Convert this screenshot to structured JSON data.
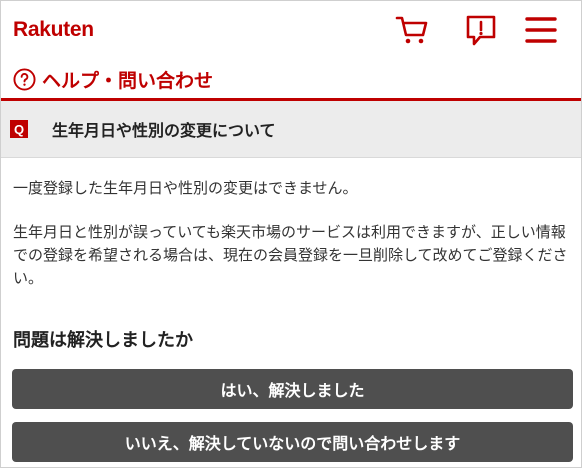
{
  "header": {
    "logo_text": "Rakuten",
    "icons": [
      "cart-icon",
      "notice-icon",
      "menu-icon"
    ],
    "brand_color": "#bf0000"
  },
  "help": {
    "title": "ヘルプ・問い合わせ",
    "icon": "question-circle-icon"
  },
  "question": {
    "badge": "Q",
    "text": "生年月日や性別の変更について"
  },
  "answer": {
    "paragraph1": "一度登録した生年月日や性別の変更はできません。",
    "paragraph2": "生年月日と性別が誤っていても楽天市場のサービスは利用できますが、正しい情報での登録を希望される場合は、現在の会員登録を一旦削除して改めてご登録ください。"
  },
  "feedback": {
    "prompt": "問題は解決しましたか",
    "yes_label": "はい、解決しました",
    "no_label": "いいえ、解決していないので問い合わせします",
    "button_color": "#4f4f4f"
  }
}
